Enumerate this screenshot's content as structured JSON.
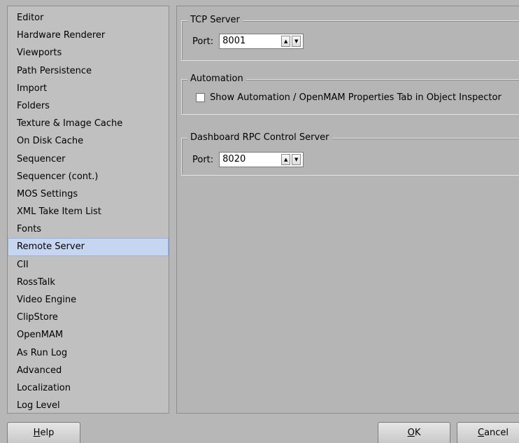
{
  "sidebar": {
    "items": [
      {
        "label": "Editor"
      },
      {
        "label": "Hardware Renderer"
      },
      {
        "label": "Viewports"
      },
      {
        "label": "Path Persistence"
      },
      {
        "label": "Import"
      },
      {
        "label": "Folders"
      },
      {
        "label": "Texture & Image Cache"
      },
      {
        "label": "On Disk Cache"
      },
      {
        "label": "Sequencer"
      },
      {
        "label": "Sequencer (cont.)"
      },
      {
        "label": "MOS Settings"
      },
      {
        "label": "XML Take Item List"
      },
      {
        "label": "Fonts"
      },
      {
        "label": "Remote Server",
        "selected": true
      },
      {
        "label": "CII"
      },
      {
        "label": "RossTalk"
      },
      {
        "label": "Video Engine"
      },
      {
        "label": "ClipStore"
      },
      {
        "label": "OpenMAM"
      },
      {
        "label": "As Run Log"
      },
      {
        "label": "Advanced"
      },
      {
        "label": "Localization"
      },
      {
        "label": "Log Level"
      }
    ]
  },
  "tcp_server": {
    "title": "TCP Server",
    "port_label": "Port:",
    "port_value": "8001"
  },
  "automation": {
    "title": "Automation",
    "checkbox_label": "Show Automation / OpenMAM Properties Tab in Object Inspector",
    "checked": false
  },
  "dashboard": {
    "title": "Dashboard RPC Control Server",
    "port_label": "Port:",
    "port_value": "8020"
  },
  "buttons": {
    "help": "Help",
    "ok": "OK",
    "cancel": "Cancel"
  },
  "colors": {
    "selection_bg": "#c7d6f0",
    "panel_bg": "#b5b5b5",
    "sidebar_bg": "#c0c0c0"
  }
}
